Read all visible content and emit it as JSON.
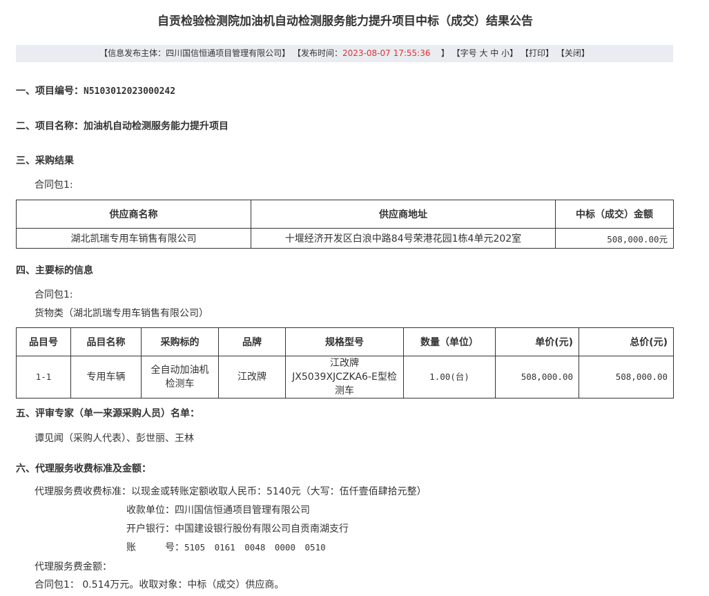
{
  "title": "自贡检验检测院加油机自动检测服务能力提升项目中标（成交）结果公告",
  "infobar": {
    "publisher_label": "【信息发布主体：",
    "publisher": "四川国信恒通项目管理有限公司",
    "publisher_end": "】",
    "time_label": "【发布时间：",
    "time": "2023-08-07 17:55:36",
    "time_end": "】",
    "font_label": "【字号",
    "font_large": "大",
    "font_medium": "中",
    "font_small": "小",
    "font_end": "】",
    "print": "【打印】",
    "close": "【关闭】",
    "time_color": "#e03131"
  },
  "sections": {
    "s1_label": "一、项目编号：",
    "s1_value": "N5103012023000242",
    "s2": "二、项目名称：加油机自动检测服务能力提升项目",
    "s3": "三、采购结果",
    "s3_package": "合同包1:",
    "s4": "四、主要标的信息",
    "s4_package": "合同包1:",
    "s4_category": "货物类（湖北凯瑞专用车销售有限公司）",
    "s5": "五、评审专家（单一来源采购人员）名单：",
    "s5_experts": "谭见闻（采购人代表）、彭世丽、王林",
    "s6": "六、代理服务收费标准及金额：",
    "s6_standard": "代理服务费收费标准：以现金或转账定额收取人民币：5140元（大写：伍仟壹佰肆拾元整）",
    "s6_payee": "收款单位：四川国信恒通项目管理有限公司",
    "s6_bank": "开户银行：中国建设银行股份有限公司自贡南湖支行",
    "s6_account_label": "账　　　号：",
    "s6_account": "5105 0161 0048 0000 0510",
    "s6_amount_label": "代理服务费金额：",
    "s6_amount": "合同包1：  0.514万元。收取对象：中标（成交）供应商。"
  },
  "result_table": {
    "headers": [
      "供应商名称",
      "供应商地址",
      "中标（成交）金额"
    ],
    "rows": [
      [
        "湖北凯瑞专用车销售有限公司",
        "十堰经济开发区白浪中路84号荣港花园1栋4单元202室",
        "508,000.00元"
      ]
    ]
  },
  "item_table": {
    "headers": [
      "品目号",
      "品目名称",
      "采购标的",
      "品牌",
      "规格型号",
      "数量（单位）",
      "单价(元)",
      "总价(元)"
    ],
    "rows": [
      [
        "1-1",
        "专用车辆",
        "全自动加油机检测车",
        "江改牌",
        "江改牌JX5039XJCZKA6-E型检测车",
        "1.00(台)",
        "508,000.00",
        "508,000.00"
      ]
    ]
  }
}
